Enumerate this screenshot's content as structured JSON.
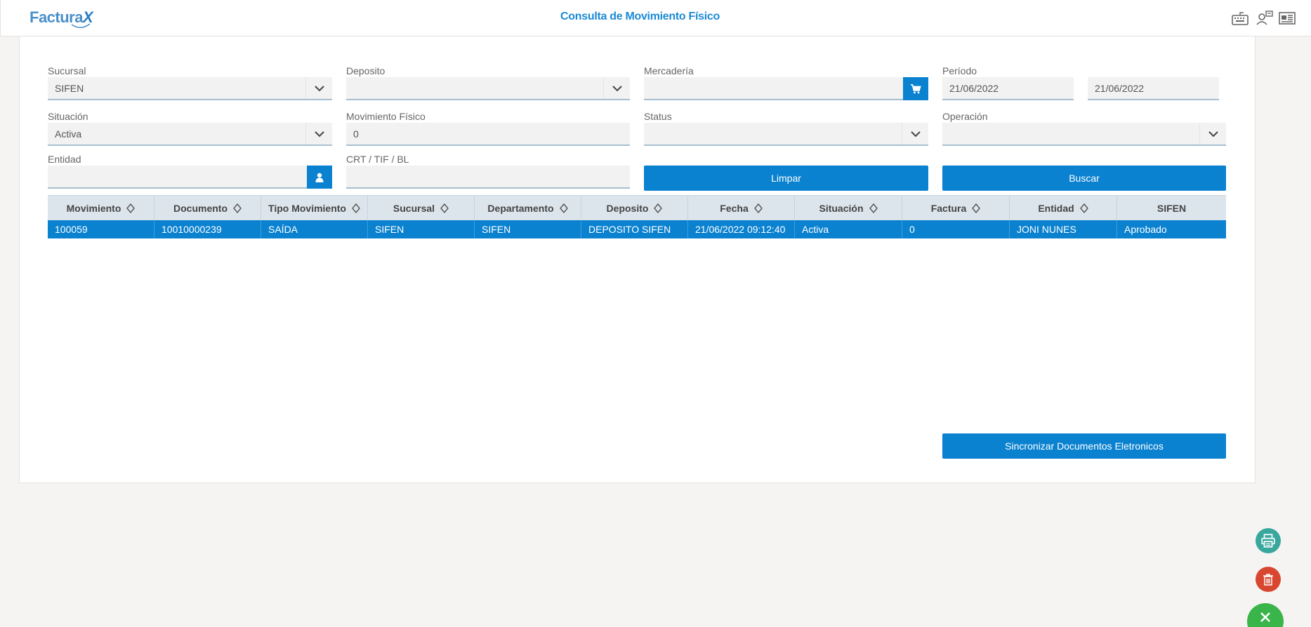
{
  "app": {
    "logo_text": "Factura",
    "logo_x": "X",
    "title": "Consulta de Movimiento Físico"
  },
  "header_icons": [
    "keyboard-icon",
    "users-network-icon",
    "news-icon"
  ],
  "filters": {
    "sucursal": {
      "label": "Sucursal",
      "value": "SIFEN"
    },
    "deposito": {
      "label": "Deposito",
      "value": ""
    },
    "mercaderia": {
      "label": "Mercadería",
      "value": ""
    },
    "periodo": {
      "label": "Período",
      "from": "21/06/2022",
      "to": "21/06/2022"
    },
    "situacion": {
      "label": "Situación",
      "value": "Activa"
    },
    "movimiento_fisico": {
      "label": "Movimiento Físico",
      "value": "0"
    },
    "status": {
      "label": "Status",
      "value": ""
    },
    "operacion": {
      "label": "Operación",
      "value": ""
    },
    "entidad": {
      "label": "Entidad",
      "value": ""
    },
    "crt": {
      "label": "CRT / TIF / BL",
      "value": ""
    }
  },
  "buttons": {
    "limpiar": "Limpar",
    "buscar": "Buscar",
    "sincronizar": "Sincronizar Documentos Eletronicos"
  },
  "table": {
    "columns": [
      "Movimiento",
      "Documento",
      "Tipo Movimiento",
      "Sucursal",
      "Departamento",
      "Deposito",
      "Fecha",
      "Situación",
      "Factura",
      "Entidad",
      "SIFEN"
    ],
    "rows": [
      [
        "100059",
        "10010000239",
        "SAÍDA",
        "SIFEN",
        "SIFEN",
        "DEPOSITO SIFEN",
        "21/06/2022 09:12:40",
        "Activa",
        "0",
        "JONI NUNES",
        "Aprobado"
      ]
    ]
  },
  "colors": {
    "primary": "#0a82d0",
    "title": "#1b8ad6",
    "print_fab": "#3aa79f",
    "delete_fab": "#d9462f",
    "close_fab": "#3ab54a"
  }
}
